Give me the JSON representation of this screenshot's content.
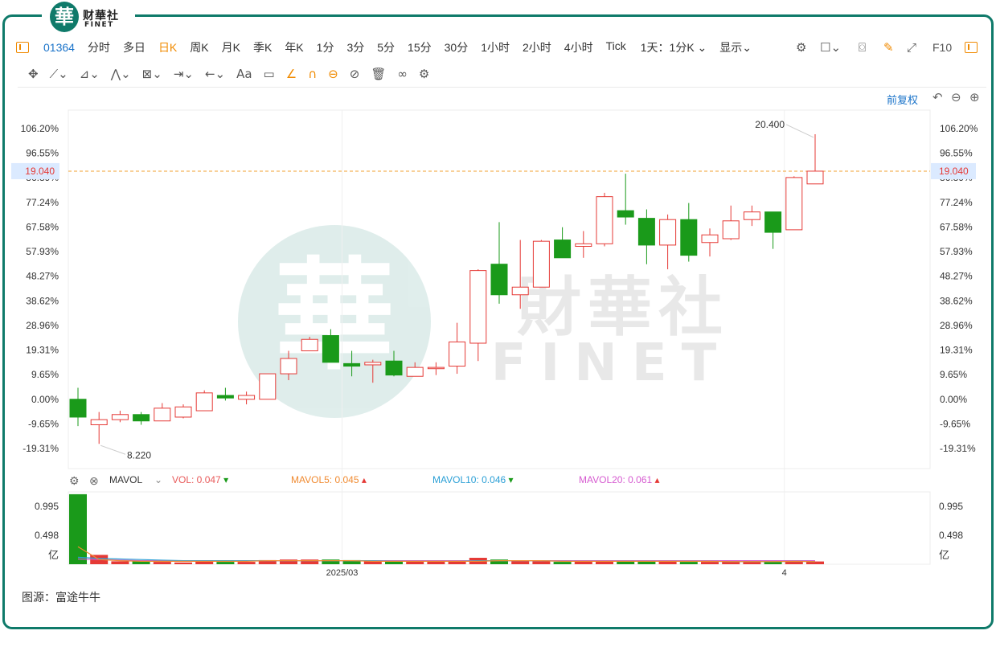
{
  "brand": {
    "logo_char": "華",
    "name_cn": "财華社",
    "name_en": "FINET"
  },
  "watermark": {
    "char": "華",
    "text_cn": "財華社",
    "text_en": "FINET"
  },
  "toolbar": {
    "code": "01364",
    "items": [
      "分时",
      "多日",
      "日K",
      "周K",
      "月K",
      "季K",
      "年K",
      "1分",
      "3分",
      "5分",
      "15分",
      "30分",
      "1小时",
      "2小时",
      "4小时",
      "Tick",
      "1天：1分K ⌄",
      "显示⌄"
    ],
    "active": "日K",
    "right_text": "F10"
  },
  "drawing_tools": [
    "✥",
    "⟋⌄",
    "⊿⌄",
    "⋀⌄",
    "⊠⌄",
    "⇥⌄",
    "←⌄",
    "Aa",
    "▭",
    "∠",
    "∩",
    "⊖",
    "⊘",
    "🗑",
    "∞",
    "⚙"
  ],
  "adjust_label": "前复权",
  "price_label": {
    "value": "19.040",
    "color": "#e53935"
  },
  "high_label": "20.400",
  "low_label": "8.220",
  "volume_indicator": {
    "name": "MAVOL",
    "vol": "VOL: 0.047",
    "mavol5": "MAVOL5: 0.045",
    "mavol10": "MAVOL10: 0.046",
    "mavol20": "MAVOL20: 0.061",
    "colors": {
      "vol": "#e85a5a",
      "mavol5": "#f08a30",
      "mavol10": "#2a9fd6",
      "mavol20": "#d65ad0"
    }
  },
  "source": "图源：富途牛牛",
  "colors": {
    "up": "#e53935",
    "down": "#1a9a1a",
    "accent": "#f08a00",
    "link": "#1a73c9",
    "frame": "#0f7a6a"
  },
  "chart_data": {
    "type": "candlestick",
    "y_axis_left": [
      "106.20%",
      "96.55%",
      "86.89%",
      "77.24%",
      "67.58%",
      "57.93%",
      "48.27%",
      "38.62%",
      "28.96%",
      "19.31%",
      "9.65%",
      "0.00%",
      "-9.65%",
      "-19.31%"
    ],
    "y_axis_right": [
      "106.20%",
      "96.55%",
      "86.89%",
      "77.24%",
      "67.58%",
      "57.93%",
      "48.27%",
      "38.62%",
      "28.96%",
      "19.31%",
      "9.65%",
      "0.00%",
      "-9.65%",
      "-19.31%"
    ],
    "ylim_pct": [
      -19.31,
      106.2
    ],
    "x_labels": [
      {
        "index": 13,
        "label": "2025/03"
      },
      {
        "index": 34,
        "label": "4"
      }
    ],
    "volume_axis": [
      "0.995",
      "0.498",
      "亿"
    ],
    "candles": [
      {
        "o": 0.0,
        "c": -7.0,
        "h": 4.5,
        "l": -10.5
      },
      {
        "o": -10.0,
        "c": -8.0,
        "h": -5.0,
        "l": -17.5
      },
      {
        "o": -8.0,
        "c": -6.0,
        "h": -4.5,
        "l": -9.0
      },
      {
        "o": -6.0,
        "c": -8.5,
        "h": -5.0,
        "l": -10.0
      },
      {
        "o": -8.5,
        "c": -3.5,
        "h": -1.5,
        "l": -8.5
      },
      {
        "o": -7.0,
        "c": -3.0,
        "h": -2.0,
        "l": -7.5
      },
      {
        "o": -4.5,
        "c": 2.5,
        "h": 3.5,
        "l": -4.5
      },
      {
        "o": 1.5,
        "c": 0.5,
        "h": 4.5,
        "l": -0.5
      },
      {
        "o": 0.0,
        "c": 1.5,
        "h": 3.0,
        "l": -2.0
      },
      {
        "o": 0.0,
        "c": 10.0,
        "h": 10.0,
        "l": 0.0
      },
      {
        "o": 10.0,
        "c": 16.0,
        "h": 19.0,
        "l": 7.5
      },
      {
        "o": 19.0,
        "c": 23.5,
        "h": 24.5,
        "l": 19.0
      },
      {
        "o": 25.0,
        "c": 14.5,
        "h": 27.5,
        "l": 14.5
      },
      {
        "o": 14.0,
        "c": 13.0,
        "h": 19.0,
        "l": 9.0
      },
      {
        "o": 13.5,
        "c": 14.5,
        "h": 15.5,
        "l": 6.5
      },
      {
        "o": 15.0,
        "c": 9.5,
        "h": 19.0,
        "l": 9.0
      },
      {
        "o": 9.0,
        "c": 12.5,
        "h": 14.5,
        "l": 9.0
      },
      {
        "o": 12.0,
        "c": 12.5,
        "h": 14.5,
        "l": 9.5
      },
      {
        "o": 13.0,
        "c": 22.5,
        "h": 30.0,
        "l": 10.0
      },
      {
        "o": 22.0,
        "c": 50.5,
        "h": 51.0,
        "l": 15.0
      },
      {
        "o": 53.0,
        "c": 41.0,
        "h": 69.5,
        "l": 37.5
      },
      {
        "o": 41.0,
        "c": 44.0,
        "h": 62.5,
        "l": 35.5
      },
      {
        "o": 44.0,
        "c": 62.0,
        "h": 62.5,
        "l": 44.0
      },
      {
        "o": 62.5,
        "c": 55.5,
        "h": 67.5,
        "l": 55.5
      },
      {
        "o": 60.0,
        "c": 61.0,
        "h": 66.0,
        "l": 55.5
      },
      {
        "o": 61.0,
        "c": 79.5,
        "h": 81.0,
        "l": 60.0
      },
      {
        "o": 74.0,
        "c": 71.5,
        "h": 88.5,
        "l": 68.5
      },
      {
        "o": 71.0,
        "c": 60.5,
        "h": 74.5,
        "l": 53.0
      },
      {
        "o": 60.5,
        "c": 70.5,
        "h": 72.5,
        "l": 51.0
      },
      {
        "o": 70.5,
        "c": 56.5,
        "h": 77.0,
        "l": 54.0
      },
      {
        "o": 61.5,
        "c": 64.5,
        "h": 67.0,
        "l": 56.0
      },
      {
        "o": 63.0,
        "c": 70.0,
        "h": 76.0,
        "l": 62.5
      },
      {
        "o": 70.5,
        "c": 73.5,
        "h": 76.0,
        "l": 68.0
      },
      {
        "o": 73.5,
        "c": 65.5,
        "h": 73.5,
        "l": 59.0
      },
      {
        "o": 66.5,
        "c": 87.0,
        "h": 87.5,
        "l": 66.5
      },
      {
        "o": 84.5,
        "c": 89.5,
        "h": 104.0,
        "l": 84.5
      }
    ],
    "volume": [
      1.2,
      0.16,
      0.05,
      0.05,
      0.04,
      0.03,
      0.06,
      0.04,
      0.04,
      0.07,
      0.08,
      0.08,
      0.08,
      0.07,
      0.06,
      0.05,
      0.05,
      0.05,
      0.05,
      0.11,
      0.08,
      0.06,
      0.05,
      0.04,
      0.05,
      0.05,
      0.05,
      0.05,
      0.05,
      0.04,
      0.04,
      0.05,
      0.05,
      0.04,
      0.06,
      0.047
    ],
    "mavol5_line": [
      0.3,
      0.08,
      0.06,
      0.05,
      0.05,
      0.05,
      0.05,
      0.05,
      0.05,
      0.06,
      0.06,
      0.06,
      0.06,
      0.06,
      0.05,
      0.05,
      0.05,
      0.05,
      0.05,
      0.05,
      0.06,
      0.06,
      0.06,
      0.05,
      0.05,
      0.05,
      0.05,
      0.05,
      0.05,
      0.05,
      0.05,
      0.045,
      0.045,
      0.045,
      0.05,
      0.045
    ],
    "mavol10_line": [
      0.12,
      0.1,
      0.09,
      0.08,
      0.07,
      0.06,
      0.06,
      0.06,
      0.06,
      0.06,
      0.06,
      0.06,
      0.06,
      0.06,
      0.06,
      0.05,
      0.05,
      0.05,
      0.05,
      0.06,
      0.06,
      0.06,
      0.06,
      0.05,
      0.05,
      0.05,
      0.05,
      0.05,
      0.05,
      0.05,
      0.05,
      0.045,
      0.045,
      0.045,
      0.05,
      0.046
    ],
    "mavol20_line": [
      0.09,
      0.08,
      0.07,
      0.06,
      0.06,
      0.06,
      0.06,
      0.06,
      0.06,
      0.06,
      0.06,
      0.06,
      0.06,
      0.06,
      0.06,
      0.06,
      0.06,
      0.06,
      0.06,
      0.06,
      0.06,
      0.06,
      0.06,
      0.06,
      0.06,
      0.06,
      0.06,
      0.06,
      0.06,
      0.06,
      0.06,
      0.06,
      0.06,
      0.06,
      0.06,
      0.061
    ]
  }
}
